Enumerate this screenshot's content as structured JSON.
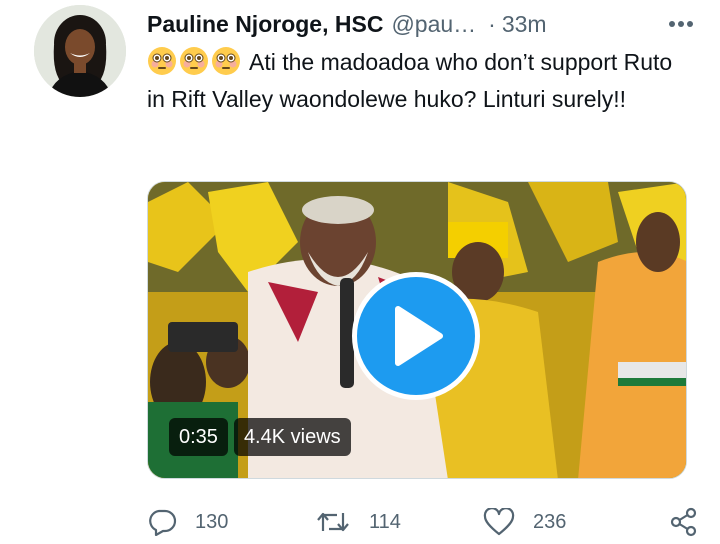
{
  "tweet": {
    "display_name": "Pauline Njoroge, HSC",
    "handle": "@pau…",
    "separator": "·",
    "timestamp": "33m",
    "text": "Ati the madoadoa who don’t support Ruto in Rift Valley waondolewe huko? Linturi surely!!",
    "emoji": [
      "flushed-face",
      "flushed-face",
      "flushed-face"
    ]
  },
  "media": {
    "duration": "0:35",
    "views": "4.4K views",
    "play_icon": "play-icon"
  },
  "actions": {
    "reply_count": "130",
    "retweet_count": "114",
    "like_count": "236"
  },
  "colors": {
    "accent": "#1d9bf0",
    "text": "#0f1419",
    "secondary": "#536471"
  }
}
